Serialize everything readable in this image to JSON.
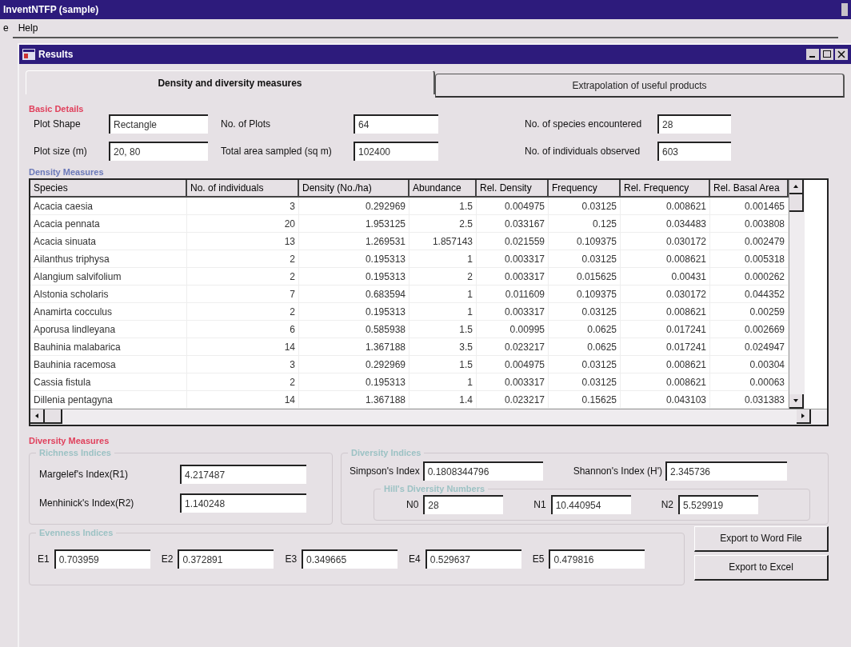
{
  "app": {
    "title": "InventNTFP (sample)",
    "menu": [
      "e",
      "Help"
    ]
  },
  "window": {
    "title": "Results"
  },
  "tabs": [
    {
      "label": "Density and diversity measures",
      "selected": true
    },
    {
      "label": "Extrapolation of useful products",
      "selected": false
    }
  ],
  "basic_details": {
    "title": "Basic Details",
    "fields": [
      {
        "label": "Plot Shape",
        "value": "Rectangle"
      },
      {
        "label": "No. of Plots",
        "value": "64"
      },
      {
        "label": "No. of species encountered",
        "value": "28"
      },
      {
        "label": "Plot size (m)",
        "value": "20, 80"
      },
      {
        "label": "Total area sampled (sq m)",
        "value": "102400"
      },
      {
        "label": "No. of individuals observed",
        "value": "603"
      }
    ]
  },
  "density_measures": {
    "title": "Density Measures",
    "columns": [
      "Species",
      "No. of individuals",
      "Density (No./ha)",
      "Abundance",
      "Rel. Density",
      "Frequency",
      "Rel. Frequency",
      "Rel. Basal Area"
    ],
    "rows": [
      [
        "Acacia caesia",
        "3",
        "0.292969",
        "1.5",
        "0.004975",
        "0.03125",
        "0.008621",
        "0.001465"
      ],
      [
        "Acacia pennata",
        "20",
        "1.953125",
        "2.5",
        "0.033167",
        "0.125",
        "0.034483",
        "0.003808"
      ],
      [
        "Acacia sinuata",
        "13",
        "1.269531",
        "1.857143",
        "0.021559",
        "0.109375",
        "0.030172",
        "0.002479"
      ],
      [
        "Ailanthus triphysa",
        "2",
        "0.195313",
        "1",
        "0.003317",
        "0.03125",
        "0.008621",
        "0.005318"
      ],
      [
        "Alangium salvifolium",
        "2",
        "0.195313",
        "2",
        "0.003317",
        "0.015625",
        "0.00431",
        "0.000262"
      ],
      [
        "Alstonia scholaris",
        "7",
        "0.683594",
        "1",
        "0.011609",
        "0.109375",
        "0.030172",
        "0.044352"
      ],
      [
        "Anamirta cocculus",
        "2",
        "0.195313",
        "1",
        "0.003317",
        "0.03125",
        "0.008621",
        "0.00259"
      ],
      [
        "Aporusa lindleyana",
        "6",
        "0.585938",
        "1.5",
        "0.00995",
        "0.0625",
        "0.017241",
        "0.002669"
      ],
      [
        "Bauhinia malabarica",
        "14",
        "1.367188",
        "3.5",
        "0.023217",
        "0.0625",
        "0.017241",
        "0.024947"
      ],
      [
        "Bauhinia racemosa",
        "3",
        "0.292969",
        "1.5",
        "0.004975",
        "0.03125",
        "0.008621",
        "0.00304"
      ],
      [
        "Cassia fistula",
        "2",
        "0.195313",
        "1",
        "0.003317",
        "0.03125",
        "0.008621",
        "0.00063"
      ],
      [
        "Dillenia pentagyna",
        "14",
        "1.367188",
        "1.4",
        "0.023217",
        "0.15625",
        "0.043103",
        "0.031383"
      ]
    ]
  },
  "diversity_measures": {
    "title": "Diversity Measures",
    "richness": {
      "title": "Richness Indices",
      "fields": [
        {
          "label": "Margelef's Index(R1)",
          "value": "4.217487"
        },
        {
          "label": "Menhinick's Index(R2)",
          "value": "1.140248"
        }
      ]
    },
    "diversity": {
      "title": "Diversity Indices",
      "fields": [
        {
          "label": "Simpson's Index",
          "value": "0.1808344796"
        },
        {
          "label": "Shannon's Index (H')",
          "value": "2.345736"
        }
      ],
      "hill": {
        "title": "Hill's Diversity Numbers",
        "fields": [
          {
            "label": "N0",
            "value": "28"
          },
          {
            "label": "N1",
            "value": "10.440954"
          },
          {
            "label": "N2",
            "value": "5.529919"
          }
        ]
      }
    },
    "evenness": {
      "title": "Evenness Indices",
      "fields": [
        {
          "label": "E1",
          "value": "0.703959"
        },
        {
          "label": "E2",
          "value": "0.372891"
        },
        {
          "label": "E3",
          "value": "0.349665"
        },
        {
          "label": "E4",
          "value": "0.529637"
        },
        {
          "label": "E5",
          "value": "0.479816"
        }
      ]
    },
    "buttons": [
      "Export to Word File",
      "Export to Excel"
    ]
  }
}
